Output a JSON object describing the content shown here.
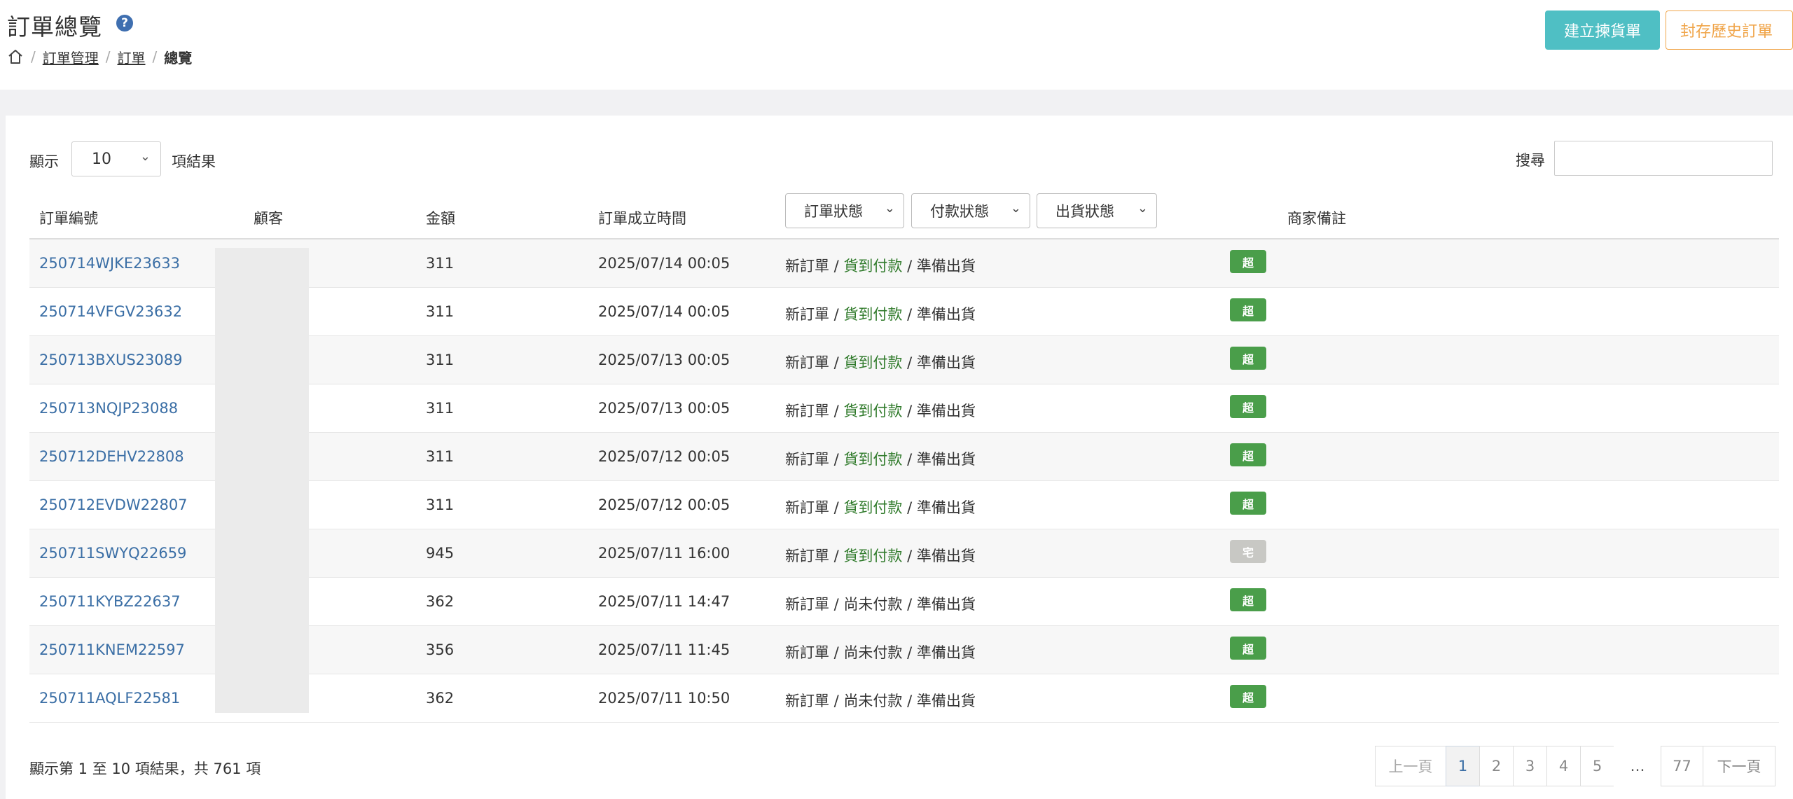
{
  "header": {
    "title": "訂單總覽",
    "help_icon": "?",
    "breadcrumb": [
      "訂單管理",
      "訂單",
      "總覽"
    ],
    "btn_picklist": "建立揀貨單",
    "btn_archive": "封存歷史訂單"
  },
  "controls": {
    "show_label": "顯示",
    "page_length": "10",
    "result_label": "項結果",
    "search_label": "搜尋"
  },
  "table": {
    "columns": {
      "order_no": "訂單編號",
      "customer": "顧客",
      "amount": "金額",
      "created": "訂單成立時間",
      "order_status": "訂單狀態",
      "payment_status": "付款狀態",
      "shipping_status": "出貨狀態",
      "note": "商家備註"
    },
    "rows": [
      {
        "order_no": "250714WJKE23633",
        "amount": "311",
        "created": "2025/07/14 00:05",
        "status": "新訂單",
        "payment": "貨到付款",
        "shipping": "準備出貨",
        "badge": "超"
      },
      {
        "order_no": "250714VFGV23632",
        "amount": "311",
        "created": "2025/07/14 00:05",
        "status": "新訂單",
        "payment": "貨到付款",
        "shipping": "準備出貨",
        "badge": "超"
      },
      {
        "order_no": "250713BXUS23089",
        "amount": "311",
        "created": "2025/07/13 00:05",
        "status": "新訂單",
        "payment": "貨到付款",
        "shipping": "準備出貨",
        "badge": "超"
      },
      {
        "order_no": "250713NQJP23088",
        "amount": "311",
        "created": "2025/07/13 00:05",
        "status": "新訂單",
        "payment": "貨到付款",
        "shipping": "準備出貨",
        "badge": "超"
      },
      {
        "order_no": "250712DEHV22808",
        "amount": "311",
        "created": "2025/07/12 00:05",
        "status": "新訂單",
        "payment": "貨到付款",
        "shipping": "準備出貨",
        "badge": "超"
      },
      {
        "order_no": "250712EVDW22807",
        "amount": "311",
        "created": "2025/07/12 00:05",
        "status": "新訂單",
        "payment": "貨到付款",
        "shipping": "準備出貨",
        "badge": "超"
      },
      {
        "order_no": "250711SWYQ22659",
        "amount": "945",
        "created": "2025/07/11 16:00",
        "status": "新訂單",
        "payment": "貨到付款",
        "shipping": "準備出貨",
        "badge": "宅"
      },
      {
        "order_no": "250711KYBZ22637",
        "amount": "362",
        "created": "2025/07/11 14:47",
        "status": "新訂單",
        "payment": "尚未付款",
        "shipping": "準備出貨",
        "badge": "超"
      },
      {
        "order_no": "250711KNEM22597",
        "amount": "356",
        "created": "2025/07/11 11:45",
        "status": "新訂單",
        "payment": "尚未付款",
        "shipping": "準備出貨",
        "badge": "超"
      },
      {
        "order_no": "250711AQLF22581",
        "amount": "362",
        "created": "2025/07/11 10:50",
        "status": "新訂單",
        "payment": "尚未付款",
        "shipping": "準備出貨",
        "badge": "超"
      }
    ]
  },
  "footer": {
    "info": "顯示第 1 至 10 項結果，共 761 項",
    "prev": "上一頁",
    "pages": [
      "1",
      "2",
      "3",
      "4",
      "5"
    ],
    "ellipsis": "…",
    "last_page": "77",
    "next": "下一頁"
  },
  "colors": {
    "badge_super": "#4a9e4a",
    "badge_home": "#c8c8c4",
    "link": "#3a6ea5",
    "cod_green": "#2f7a2a",
    "btn_teal": "#4fbfc4",
    "btn_orange": "#f0a54a"
  }
}
